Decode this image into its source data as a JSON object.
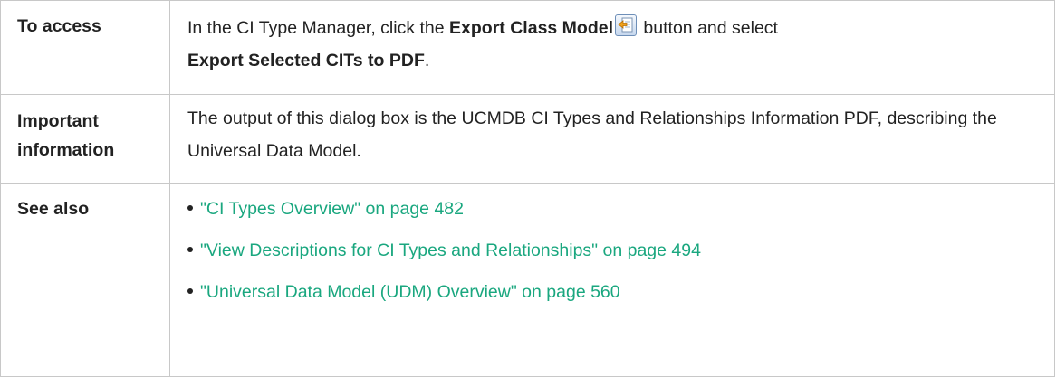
{
  "rows": {
    "access": {
      "label": "To access",
      "text_before": "In the CI Type Manager, click the ",
      "button_name": "Export Class Model",
      "text_middle": " button and select ",
      "menu_option": "Export Selected CITs to PDF",
      "text_end": "."
    },
    "important": {
      "label_line1": "Important",
      "label_line2": "information",
      "text": "The output of this dialog box is the UCMDB CI Types and Relationships Information PDF, describing the Universal Data Model."
    },
    "see_also": {
      "label": "See also",
      "links": [
        "\"CI Types Overview\" on page 482",
        "\"View Descriptions for CI Types and Relationships\" on page 494",
        "\"Universal Data Model (UDM) Overview\" on page 560"
      ]
    }
  },
  "colors": {
    "link": "#1aa77f",
    "border": "#c8c8c8"
  },
  "icons": {
    "export_class_model": "export-class-model-icon"
  }
}
